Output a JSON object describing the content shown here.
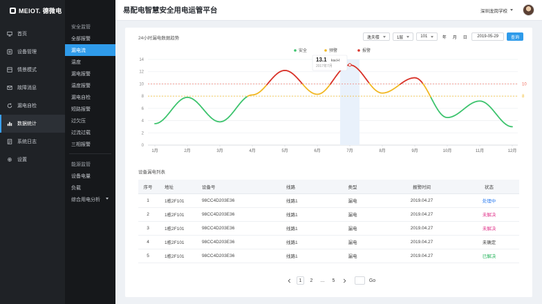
{
  "brand": {
    "name": "MEIOT. 德微电"
  },
  "nav": [
    {
      "label": "首页",
      "icon": "monitor-icon"
    },
    {
      "label": "设备管理",
      "icon": "device-icon"
    },
    {
      "label": "情景模式",
      "icon": "scene-icon"
    },
    {
      "label": "故障消息",
      "icon": "mail-icon"
    },
    {
      "label": "漏电自检",
      "icon": "refresh-icon"
    },
    {
      "label": "数据统计",
      "icon": "bar-chart-icon"
    },
    {
      "label": "系统日志",
      "icon": "log-icon"
    },
    {
      "label": "设置",
      "icon": "gear-icon"
    }
  ],
  "subnav": {
    "group1": "安全监管",
    "items1": [
      "全部报警",
      "漏电流",
      "温度",
      "漏电报警",
      "温度报警",
      "漏电自检",
      "短路报警",
      "过欠压",
      "过流过载",
      "三相报警"
    ],
    "group2": "能源监管",
    "items2": [
      "设备电量",
      "负载",
      "综合用电分析"
    ]
  },
  "header": {
    "title": "易配电智慧安全用电运管平台",
    "school": "深圳龙岗学校"
  },
  "chart_section": {
    "title": "24小时漏电数据趋势",
    "filters": {
      "building": "逸夫楼",
      "floor": "1层",
      "room": "101",
      "year": "年",
      "month": "月",
      "day": "日",
      "date": "2019-05-29",
      "query": "查询"
    }
  },
  "chart_data": {
    "type": "line",
    "categories": [
      "1月",
      "2月",
      "3月",
      "4月",
      "5月",
      "6月",
      "7月",
      "8月",
      "9月",
      "10月",
      "11月",
      "12月"
    ],
    "values": [
      3.5,
      7.8,
      3.8,
      8.2,
      12.2,
      8.3,
      13.1,
      8.5,
      11.0,
      4.5,
      7.2,
      3.0
    ],
    "ylim": [
      0,
      14
    ],
    "yticks": [
      0,
      2,
      4,
      6,
      8,
      10,
      12,
      14
    ],
    "legend": {
      "position": "top-center",
      "entries": [
        {
          "name": "安全",
          "color": "#3fc46f"
        },
        {
          "name": "预警",
          "color": "#f1b825"
        },
        {
          "name": "报警",
          "color": "#d9342b"
        }
      ]
    },
    "thresholds": [
      {
        "value": 10,
        "label": "10",
        "color": "#f26b5b"
      },
      {
        "value": 8,
        "label": "8",
        "color": "#f1b825"
      }
    ],
    "tooltip": {
      "category": "7月",
      "value": "13.1",
      "unit": "kw.H",
      "date": "2017年7月"
    },
    "grid": true
  },
  "table": {
    "title": "设备漏电列表",
    "columns": [
      "序号",
      "地址",
      "设备号",
      "线路",
      "类型",
      "报警时间",
      "状态"
    ],
    "rows": [
      {
        "seq": "1",
        "addr": "1栋2F101",
        "device": "98CC4D203E36",
        "line": "线路1",
        "type": "漏电",
        "time": "2019.04.27",
        "status": "处理中",
        "status_color": "#2f7ef0"
      },
      {
        "seq": "2",
        "addr": "1栋2F101",
        "device": "98CC4D203E36",
        "line": "线路1",
        "type": "漏电",
        "time": "2019.04.27",
        "status": "未解决",
        "status_color": "#e0328a"
      },
      {
        "seq": "3",
        "addr": "1栋2F101",
        "device": "98CC4D203E36",
        "line": "线路1",
        "type": "漏电",
        "time": "2019.04.27",
        "status": "未解决",
        "status_color": "#e0328a"
      },
      {
        "seq": "4",
        "addr": "1栋2F101",
        "device": "98CC4D203E36",
        "line": "线路1",
        "type": "漏电",
        "time": "2019.04.27",
        "status": "未确定",
        "status_color": "#444444"
      },
      {
        "seq": "5",
        "addr": "1栋2F101",
        "device": "98CC4D203E36",
        "line": "线路1",
        "type": "漏电",
        "time": "2019.04.27",
        "status": "已解决",
        "status_color": "#23b35a"
      }
    ]
  },
  "pager": {
    "pages": [
      "1",
      "2",
      "...",
      "5"
    ],
    "current": "1",
    "go": "Go"
  }
}
